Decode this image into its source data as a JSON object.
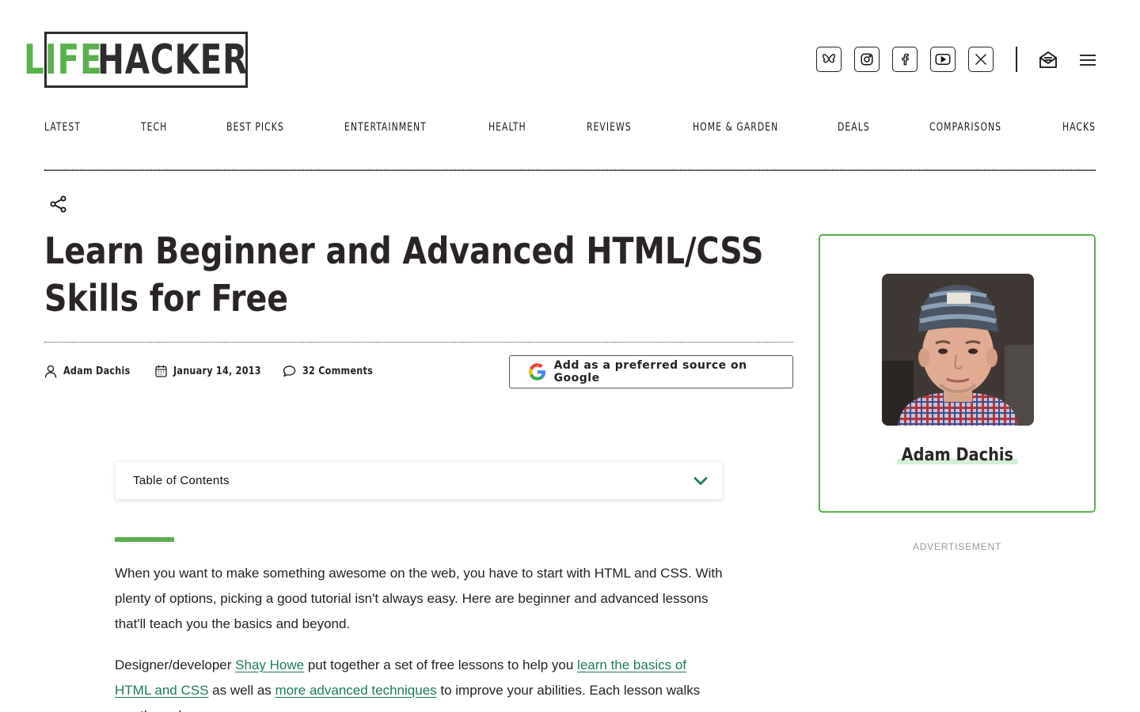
{
  "brand": {
    "part1": "LIFE",
    "part2": "HACKER",
    "accent_color": "#5ab04d",
    "dark_color": "#2d2d2d"
  },
  "header": {
    "social": [
      "bluesky-icon",
      "instagram-icon",
      "facebook-icon",
      "youtube-icon",
      "x-icon"
    ],
    "newsletter_icon": "newsletter-icon",
    "menu_icon": "hamburger-menu-icon"
  },
  "nav": {
    "items": [
      "LATEST",
      "TECH",
      "BEST PICKS",
      "ENTERTAINMENT",
      "HEALTH",
      "REVIEWS",
      "HOME & GARDEN",
      "DEALS",
      "COMPARISONS",
      "HACKS"
    ]
  },
  "article": {
    "title": "Learn Beginner and Advanced HTML/CSS Skills for Free",
    "author": "Adam Dachis",
    "date": "January 14, 2013",
    "comments": "32 Comments",
    "google_button": "Add as a preferred source on Google",
    "toc_label": "Table of Contents",
    "para1": "When you want to make something awesome on the web, you have to start with HTML and CSS. With plenty of options, picking a good tutorial isn't always easy. Here are beginner and advanced lessons that'll teach you the basics and beyond.",
    "para2": {
      "t1": "Designer/developer ",
      "link1": "Shay Howe",
      "t2": " put together a set of free lessons to help you ",
      "link2": "learn the basics of HTML and CSS",
      "t3": " as well as ",
      "link3": "more advanced techniques",
      "t4": " to improve your abilities. Each lesson walks you through"
    }
  },
  "sidebar": {
    "author_name": "Adam Dachis",
    "ad_label": "ADVERTISEMENT"
  },
  "colors": {
    "link": "#1d7d56",
    "accent": "#5ab04d",
    "title": "#2a2424"
  }
}
